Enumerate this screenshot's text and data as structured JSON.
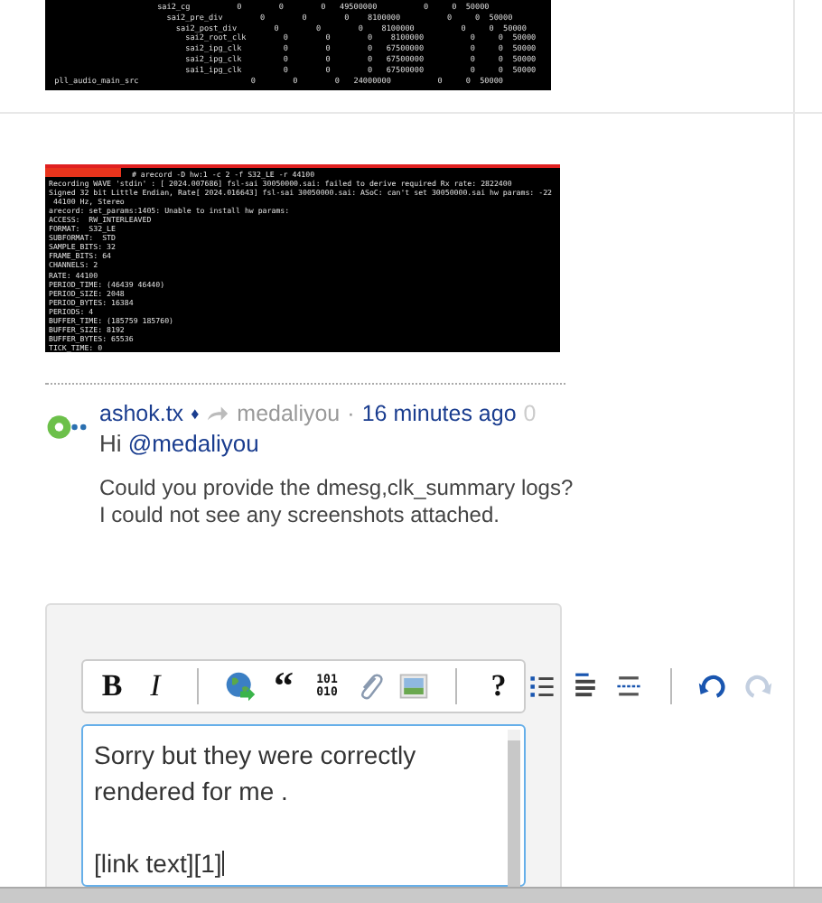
{
  "clock_screenshot": {
    "lines": [
      "                        sai2_cg          0        0        0   49500000          0     0  50000",
      "                          sai2_pre_div        0        0        0    8100000          0     0  50000",
      "                            sai2_post_div        0        0        0    8100000          0     0  50000",
      "                              sai2_root_clk        0        0        0    8100000          0     0  50000",
      "                              sai2_ipg_clk         0        0        0   67500000          0     0  50000",
      "                              sai2_ipg_clk         0        0        0   67500000          0     0  50000",
      "                              sai1_ipg_clk         0        0        0   67500000          0     0  50000",
      "  pll_audio_main_src                        0        0        0   24000000          0     0  50000"
    ]
  },
  "terminal_screenshot": {
    "lines": [
      "# arecord -D hw:1 -c 2 -f S32_LE -r 44100",
      "Recording WAVE 'stdin' : [ 2024.007686] fsl-sai 30050000.sai: failed to derive required Rx rate: 2822400",
      "Signed 32 bit Little Endian, Rate[ 2024.016643] fsl-sai 30050000.sai: ASoC: can't set 30050000.sai hw params: -22",
      " 44100 Hz, Stereo",
      "arecord: set_params:1405: Unable to install hw params:",
      "ACCESS:  RW_INTERLEAVED",
      "FORMAT:  S32_LE",
      "SUBFORMAT:  STD",
      "SAMPLE_BITS: 32",
      "FRAME_BITS: 64",
      "CHANNELS: 2",
      "RATE: 44100",
      "PERIOD_TIME: (46439 46440)",
      "PERIOD_SIZE: 2048",
      "PERIOD_BYTES: 16384",
      "PERIODS: 4",
      "BUFFER_TIME: (185759 185760)",
      "BUFFER_SIZE: 8192",
      "BUFFER_BYTES: 65536",
      "TICK_TIME: 0"
    ]
  },
  "comment": {
    "author": "ashok.tx",
    "author_mark": "♦",
    "reply_to": "medaliyou",
    "separator": "·",
    "time": "16 minutes ago",
    "votes": "0",
    "greeting_prefix": "Hi ",
    "mention": "@medaliyou",
    "body": "Could you provide the dmesg,clk_summary logs?\nI could not see any screenshots attached."
  },
  "editor": {
    "toolbar": [
      {
        "kind": "bold",
        "label": "B"
      },
      {
        "kind": "italic",
        "label": "I"
      },
      {
        "kind": "separator"
      },
      {
        "kind": "link"
      },
      {
        "kind": "quote",
        "label": "“"
      },
      {
        "kind": "code",
        "lines": [
          "101",
          "010"
        ]
      },
      {
        "kind": "attach"
      },
      {
        "kind": "image"
      },
      {
        "kind": "separator"
      },
      {
        "kind": "help",
        "label": "?"
      },
      {
        "kind": "bullets"
      },
      {
        "kind": "numbered"
      },
      {
        "kind": "rule"
      },
      {
        "kind": "separator"
      },
      {
        "kind": "undo",
        "disabled": false
      },
      {
        "kind": "redo",
        "disabled": true
      }
    ],
    "value": "Sorry but they were correctly\nrendered for me .\n\n[link text][1]"
  }
}
